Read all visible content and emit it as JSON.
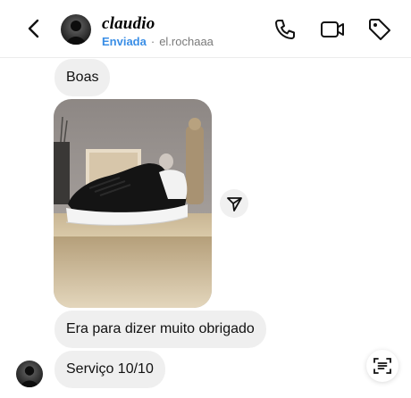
{
  "header": {
    "name": "claudio",
    "status": "Enviada",
    "separator": "·",
    "username": "el.rochaaa"
  },
  "messages": [
    {
      "type": "text",
      "text": "Boas"
    },
    {
      "type": "image",
      "description_icon": "shoe-photo"
    },
    {
      "type": "text",
      "text": "Era para dizer muito obrigado"
    },
    {
      "type": "text",
      "text": "Serviço 10/10"
    }
  ],
  "icons": {
    "back": "chevron-left-icon",
    "call": "phone-icon",
    "video": "video-camera-icon",
    "tag": "tag-icon",
    "share": "send-icon",
    "scan": "text-scan-icon"
  },
  "colors": {
    "status": "#3a8ee6",
    "bubble": "#efefef",
    "divider": "#ececec"
  }
}
